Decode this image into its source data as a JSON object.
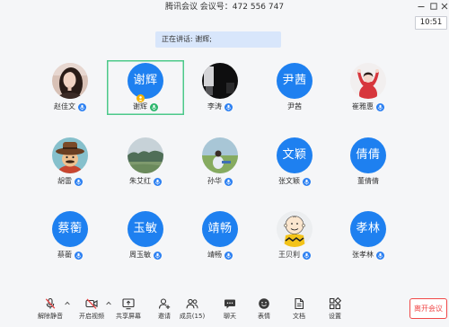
{
  "window": {
    "title": "腾讯会议 会议号：472 556 747",
    "controls": [
      "minimize-icon",
      "maximize-icon",
      "close-icon"
    ]
  },
  "clock": "10:51",
  "speaking_banner": "正在讲话: 谢辉;",
  "participants": [
    {
      "name": "赵佳文",
      "mic_icon": "mic-icon"
    },
    {
      "name": "谢辉",
      "avatar_text": "谢辉",
      "mic_icon": "mic-speaking-icon",
      "badge_icon": "host-icon",
      "active_speaker": true
    },
    {
      "name": "李涛",
      "mic_icon": "mic-icon"
    },
    {
      "name": "尹茜",
      "avatar_text": "尹茜"
    },
    {
      "name": "崔雅惠",
      "mic_icon": "mic-icon"
    },
    {
      "name": "胡雷",
      "mic_icon": "mic-icon"
    },
    {
      "name": "朱艾红",
      "mic_icon": "mic-icon"
    },
    {
      "name": "孙华",
      "mic_icon": "mic-icon"
    },
    {
      "name": "张文颖",
      "avatar_text": "文颖",
      "mic_icon": "mic-icon"
    },
    {
      "name": "董倩倩",
      "avatar_text": "倩倩"
    },
    {
      "name": "蔡蘅",
      "avatar_text": "蔡蘅",
      "mic_icon": "mic-icon"
    },
    {
      "name": "周玉敏",
      "avatar_text": "玉敏",
      "mic_icon": "mic-icon"
    },
    {
      "name": "靖畅",
      "avatar_text": "靖畅",
      "mic_icon": "mic-icon"
    },
    {
      "name": "王贝利",
      "mic_icon": "mic-icon"
    },
    {
      "name": "张孝林",
      "avatar_text": "孝林",
      "mic_icon": "mic-icon"
    }
  ],
  "toolbar": {
    "items": [
      {
        "label": "解除静音",
        "icon": "mic-muted-icon",
        "menu_icon": "chevron-up-icon"
      },
      {
        "label": "开启视频",
        "icon": "video-off-icon",
        "menu_icon": "chevron-up-icon"
      },
      {
        "label": "共享屏幕",
        "icon": "share-screen-icon"
      },
      {
        "label": "邀请",
        "icon": "invite-icon"
      },
      {
        "label": "成员(15)",
        "icon": "members-icon"
      },
      {
        "label": "聊天",
        "icon": "chat-icon"
      },
      {
        "label": "表情",
        "icon": "emoji-icon"
      },
      {
        "label": "文档",
        "icon": "document-icon"
      },
      {
        "label": "设置",
        "icon": "settings-icon"
      }
    ],
    "leave_label": "离开会议"
  },
  "colors": {
    "avatar_blue": "#1e80f0",
    "mic_blue": "#2c80f2",
    "mic_green": "#2bb56b",
    "active_border": "#4cc98a",
    "host_badge": "#f6b400",
    "banner_bg": "#d8e6fb",
    "leave_red": "#f04848",
    "muted_slash_red": "#e64545"
  }
}
